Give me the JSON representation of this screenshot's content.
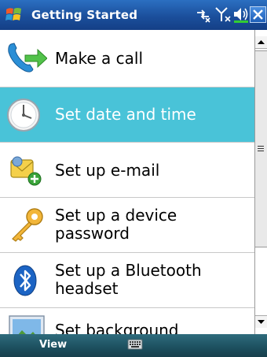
{
  "titlebar": {
    "title": "Getting Started"
  },
  "list": {
    "items": [
      {
        "label_lines": [
          "Make a call"
        ],
        "icon": "phone-call-icon",
        "selected": false
      },
      {
        "label_lines": [
          "Set date and time"
        ],
        "icon": "clock-icon",
        "selected": true
      },
      {
        "label_lines": [
          "Set up e-mail"
        ],
        "icon": "email-add-icon",
        "selected": false
      },
      {
        "label_lines": [
          "Set up a device",
          "password"
        ],
        "icon": "key-icon",
        "selected": false
      },
      {
        "label_lines": [
          "Set up a Bluetooth",
          "headset"
        ],
        "icon": "bluetooth-icon",
        "selected": false
      },
      {
        "label_lines": [
          "Set background"
        ],
        "icon": "picture-icon",
        "selected": false
      }
    ]
  },
  "menubar": {
    "left_softkey": "View"
  },
  "colors": {
    "selection": "#49c3d8",
    "titlebar": "#1b4f9c",
    "menubar": "#1c4f5e"
  }
}
